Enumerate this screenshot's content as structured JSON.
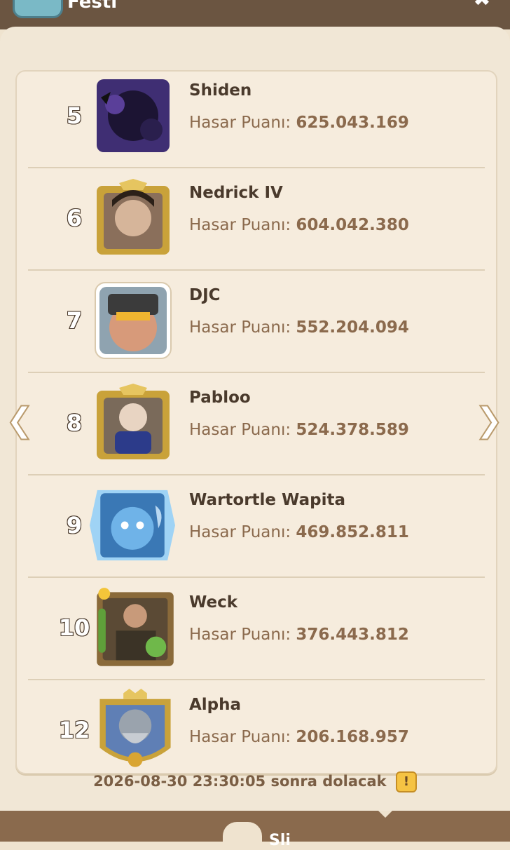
{
  "header": {
    "title": "Festi",
    "back_icon": "back-arrow-icon",
    "close_icon": "close-icon"
  },
  "leaderboard": {
    "score_label": "Hasar Puanı:",
    "rows": [
      {
        "rank": "5",
        "name": "Shiden",
        "score": "625.043.169",
        "avatar_color": "#3f2e73"
      },
      {
        "rank": "6",
        "name": "Nedrick IV",
        "score": "604.042.380",
        "avatar_color": "#c9a23a"
      },
      {
        "rank": "7",
        "name": "DJC",
        "score": "552.204.094",
        "avatar_color": "#d79a7a"
      },
      {
        "rank": "8",
        "name": "Pabloo",
        "score": "524.378.589",
        "avatar_color": "#c9a23a"
      },
      {
        "rank": "9",
        "name": "Wartortle Wapita",
        "score": "469.852.811",
        "avatar_color": "#6fb3e8"
      },
      {
        "rank": "10",
        "name": "Weck",
        "score": "376.443.812",
        "avatar_color": "#6a8a3a"
      },
      {
        "rank": "12",
        "name": "Alpha",
        "score": "206.168.957",
        "avatar_color": "#c9a23a"
      }
    ]
  },
  "navigation": {
    "prev_icon": "chevron-left-icon",
    "next_icon": "chevron-right-icon"
  },
  "footer": {
    "refill_text": "2026-08-30 23:30:05 sonra dolacak",
    "warning_icon": "exclamation-icon",
    "bottom_label": "Sli"
  },
  "colors": {
    "header_bg": "#6b5541",
    "panel_bg": "#f1e7d6",
    "name_text": "#4a3a2c",
    "score_text": "#8b6a4d"
  }
}
